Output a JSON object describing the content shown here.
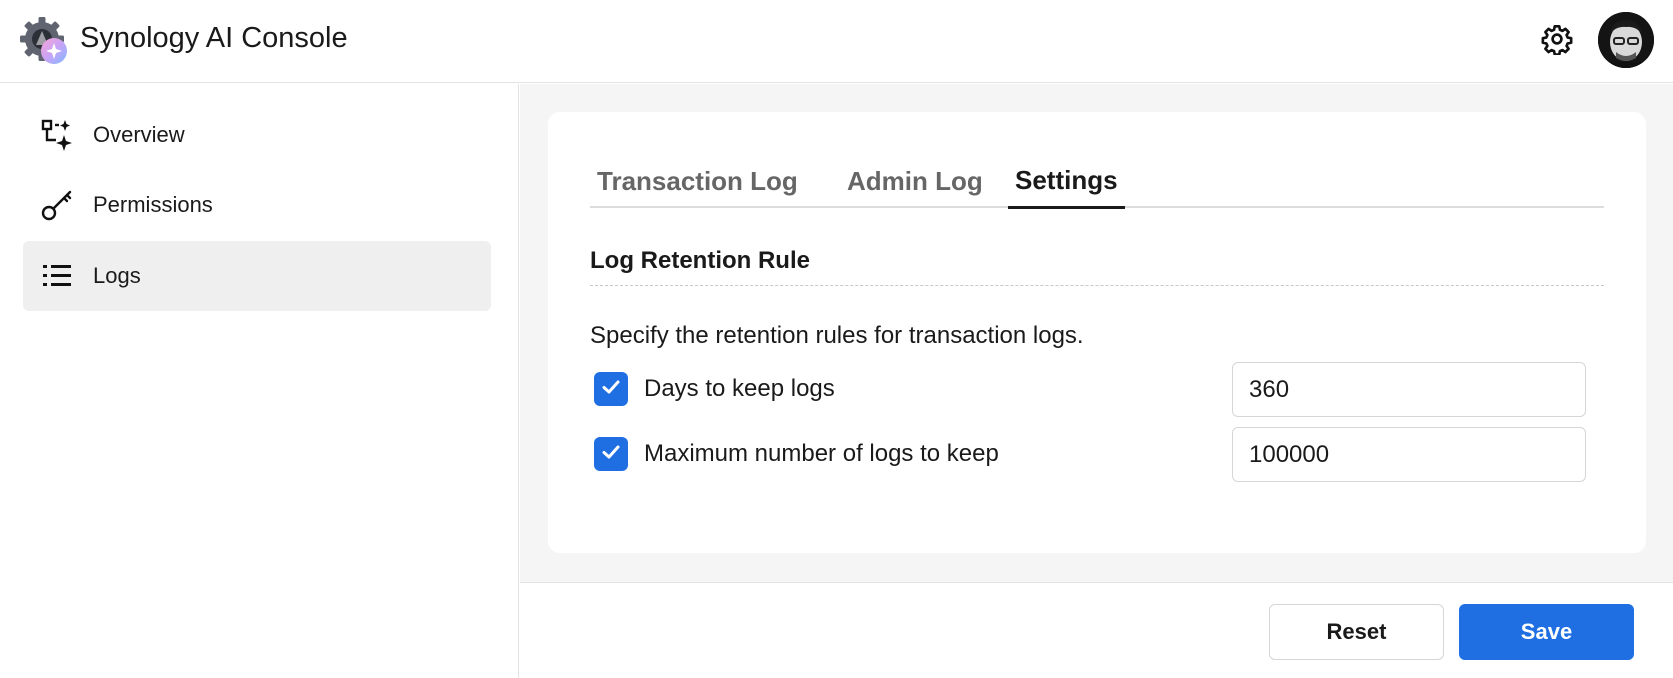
{
  "header": {
    "title": "Synology AI Console",
    "logo_icon": "synology-ai-gear-logo",
    "settings_icon": "gear-icon",
    "avatar": "user-avatar"
  },
  "sidebar": {
    "items": [
      {
        "label": "Overview",
        "icon": "overview-sparkle-icon",
        "active": false
      },
      {
        "label": "Permissions",
        "icon": "key-icon",
        "active": false
      },
      {
        "label": "Logs",
        "icon": "list-icon",
        "active": true
      }
    ]
  },
  "main": {
    "tabs": [
      {
        "label": "Transaction Log",
        "active": false
      },
      {
        "label": "Admin Log",
        "active": false
      },
      {
        "label": "Settings",
        "active": true
      }
    ],
    "section_title": "Log Retention Rule",
    "description": "Specify the retention rules for transaction logs.",
    "rules": [
      {
        "label": "Days to keep logs",
        "checked": true,
        "value": "360"
      },
      {
        "label": "Maximum number of logs to keep",
        "checked": true,
        "value": "100000"
      }
    ]
  },
  "footer": {
    "reset_label": "Reset",
    "save_label": "Save"
  },
  "colors": {
    "accent": "#1f6fe3",
    "active_nav_bg": "#efefef",
    "main_bg": "#f5f5f5"
  }
}
